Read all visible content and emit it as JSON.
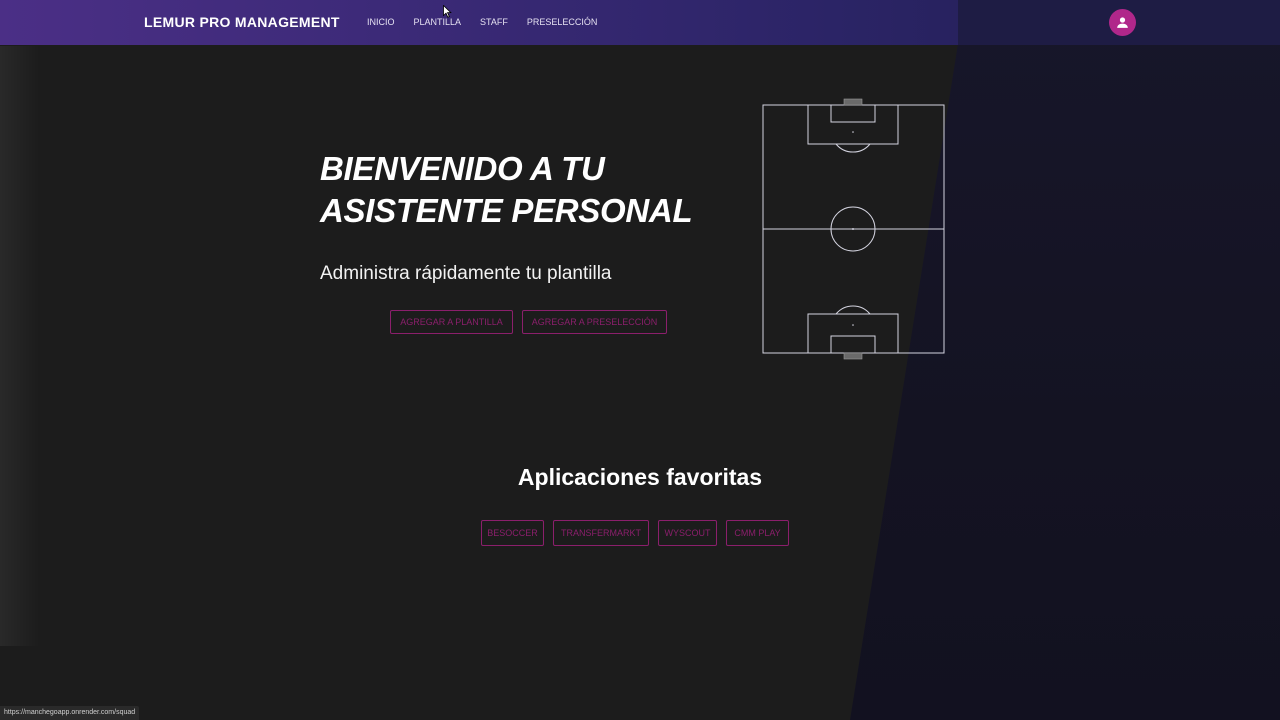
{
  "navbar": {
    "brand": "LEMUR PRO MANAGEMENT",
    "links": [
      "INICIO",
      "PLANTILLA",
      "STAFF",
      "PRESELECCIÓN"
    ],
    "avatar_icon": "user-icon",
    "accent_color": "#b0278a"
  },
  "hero": {
    "title_line1": "BIENVENIDO A TU",
    "title_line2": "ASISTENTE PERSONAL",
    "subtitle": "Administra rápidamente tu plantilla",
    "buttons": {
      "add_squad": "AGREGAR A PLANTILLA",
      "add_preselection": "AGREGAR A PRESELECCIÓN"
    }
  },
  "favorites": {
    "title": "Aplicaciones favoritas",
    "apps": [
      "BESOCCER",
      "TRANSFERMARKT",
      "WYSCOUT",
      "CMM PLAY"
    ]
  },
  "status_bar": {
    "url": "https://manchegoapp.onrender.com/squad"
  },
  "colors": {
    "button_outline": "#8b1f6c",
    "background": "#1c1c1c",
    "navbar_start": "#4b2f86",
    "navbar_end": "#1f1d4d"
  }
}
